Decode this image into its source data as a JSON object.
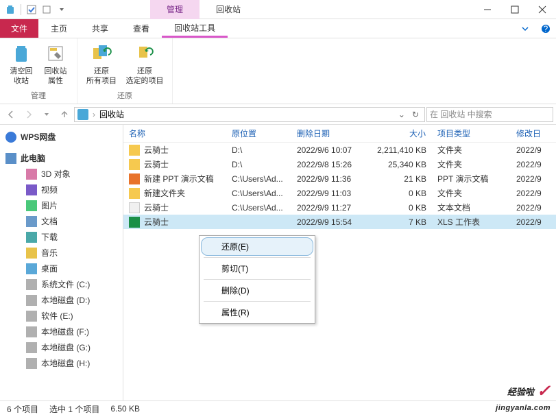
{
  "titlebar": {
    "tab_manage": "管理",
    "tab_recycle": "回收站"
  },
  "menubar": {
    "file": "文件",
    "home": "主页",
    "share": "共享",
    "view": "查看",
    "recycle_tools": "回收站工具"
  },
  "ribbon": {
    "empty_bin": "清空回\n收站",
    "bin_props": "回收站\n属性",
    "restore_all": "还原\n所有项目",
    "restore_sel": "还原\n选定的项目",
    "group_manage": "管理",
    "group_restore": "还原"
  },
  "nav": {
    "address": "回收站",
    "search_placeholder": "在 回收站 中搜索"
  },
  "sidebar": {
    "wps": "WPS网盘",
    "pc": "此电脑",
    "items": [
      {
        "label": "3D 对象"
      },
      {
        "label": "视频"
      },
      {
        "label": "图片"
      },
      {
        "label": "文档"
      },
      {
        "label": "下载"
      },
      {
        "label": "音乐"
      },
      {
        "label": "桌面"
      },
      {
        "label": "系统文件 (C:)"
      },
      {
        "label": "本地磁盘 (D:)"
      },
      {
        "label": "软件 (E:)"
      },
      {
        "label": "本地磁盘 (F:)"
      },
      {
        "label": "本地磁盘 (G:)"
      },
      {
        "label": "本地磁盘 (H:)"
      }
    ]
  },
  "columns": {
    "name": "名称",
    "location": "原位置",
    "deleted": "删除日期",
    "size": "大小",
    "type": "项目类型",
    "modified": "修改日"
  },
  "rows": [
    {
      "name": "云骑士",
      "loc": "D:\\",
      "date": "2022/9/6 10:07",
      "size": "2,211,410 KB",
      "type": "文件夹",
      "mod": "2022/9"
    },
    {
      "name": "云骑士",
      "loc": "D:\\",
      "date": "2022/9/8 15:26",
      "size": "25,340 KB",
      "type": "文件夹",
      "mod": "2022/9"
    },
    {
      "name": "新建 PPT 演示文稿",
      "loc": "C:\\Users\\Ad...",
      "date": "2022/9/9 11:36",
      "size": "21 KB",
      "type": "PPT 演示文稿",
      "mod": "2022/9"
    },
    {
      "name": "新建文件夹",
      "loc": "C:\\Users\\Ad...",
      "date": "2022/9/9 11:03",
      "size": "0 KB",
      "type": "文件夹",
      "mod": "2022/9"
    },
    {
      "name": "云骑士",
      "loc": "C:\\Users\\Ad...",
      "date": "2022/9/9 11:27",
      "size": "0 KB",
      "type": "文本文档",
      "mod": "2022/9"
    },
    {
      "name": "云骑士",
      "loc": "",
      "date": "2022/9/9 15:54",
      "size": "7 KB",
      "type": "XLS 工作表",
      "mod": "2022/9"
    }
  ],
  "context_menu": {
    "restore": "还原(E)",
    "cut": "剪切(T)",
    "delete": "删除(D)",
    "props": "属性(R)"
  },
  "status": {
    "count": "6 个项目",
    "selected": "选中 1 个项目",
    "size": "6.50 KB"
  },
  "watermark": {
    "brand": "经验啦",
    "url": "jingyanla.com"
  }
}
